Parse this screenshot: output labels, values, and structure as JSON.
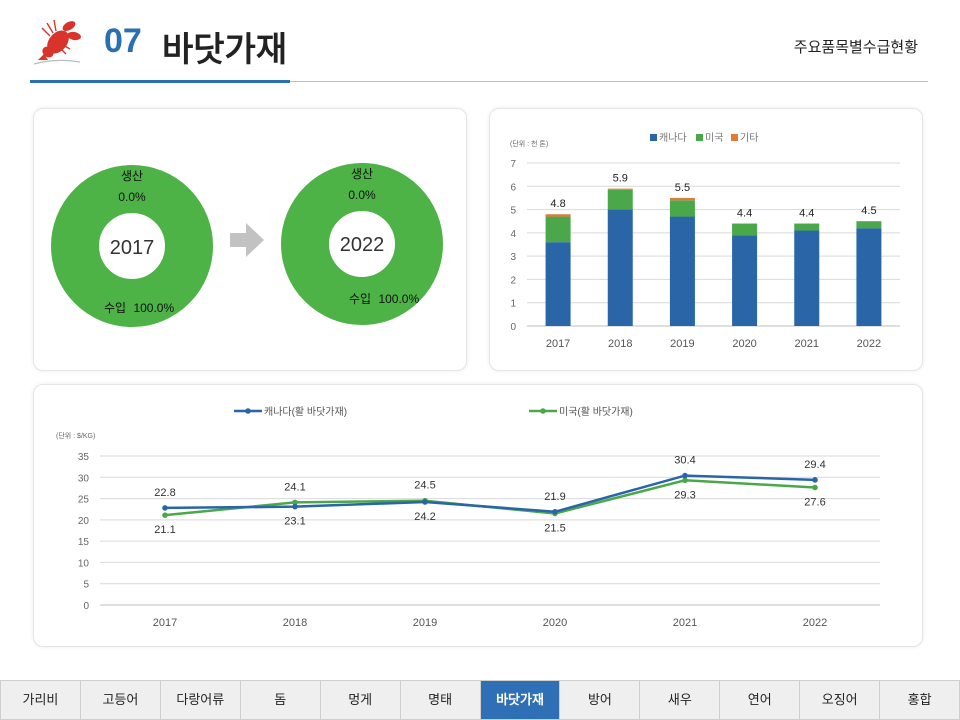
{
  "header": {
    "number": "07",
    "title": "바닷가재",
    "subtitle": "주요품목별수급현황"
  },
  "colors": {
    "accent": "#2a6fb0",
    "canada": "#2965a7",
    "usa": "#4aa84a",
    "other": "#e07b39",
    "donut": "#4db346"
  },
  "chart_data": [
    {
      "type": "pie",
      "variant": "donut",
      "center_label": "2017",
      "slices": [
        {
          "label": "생산",
          "value_text": "0.0%",
          "value": 0.0
        },
        {
          "label": "수입",
          "value_text": "100.0%",
          "value": 100.0
        }
      ]
    },
    {
      "type": "pie",
      "variant": "donut",
      "center_label": "2022",
      "slices": [
        {
          "label": "생산",
          "value_text": "0.0%",
          "value": 0.0
        },
        {
          "label": "수입",
          "value_text": "100.0%",
          "value": 100.0
        }
      ]
    },
    {
      "type": "bar",
      "stacked": true,
      "unit_note": "(단위 : 천 톤)",
      "categories": [
        "2017",
        "2018",
        "2019",
        "2020",
        "2021",
        "2022"
      ],
      "series": [
        {
          "name": "캐나다",
          "values": [
            3.6,
            5.0,
            4.7,
            3.9,
            4.1,
            4.2
          ]
        },
        {
          "name": "미국",
          "values": [
            1.1,
            0.85,
            0.7,
            0.5,
            0.3,
            0.3
          ]
        },
        {
          "name": "기타",
          "values": [
            0.1,
            0.05,
            0.1,
            0.0,
            0.0,
            0.0
          ]
        }
      ],
      "totals": [
        "4.8",
        "5.9",
        "5.5",
        "4.4",
        "4.4",
        "4.5"
      ],
      "yticks": [
        "0",
        "1",
        "2",
        "3",
        "4",
        "5",
        "6",
        "7"
      ],
      "ylim": [
        0,
        7
      ],
      "legend_position": "top"
    },
    {
      "type": "line",
      "unit_note": "(단위 : $/KG)",
      "categories": [
        "2017",
        "2018",
        "2019",
        "2020",
        "2021",
        "2022"
      ],
      "series": [
        {
          "name": "캐나다(활 바닷가재)",
          "values": [
            22.8,
            23.1,
            24.2,
            21.9,
            30.4,
            29.4
          ],
          "labels": [
            "22.8",
            "23.1",
            "24.2",
            "21.9",
            "30.4",
            "29.4"
          ]
        },
        {
          "name": "미국(활 바닷가재)",
          "values": [
            21.1,
            24.1,
            24.5,
            21.5,
            29.3,
            27.6
          ],
          "labels": [
            "21.1",
            "24.1",
            "24.5",
            "21.5",
            "29.3",
            "27.6"
          ]
        }
      ],
      "yticks": [
        "0",
        "5",
        "10",
        "15",
        "20",
        "25",
        "30",
        "35"
      ],
      "ylim": [
        0,
        35
      ],
      "legend_position": "top"
    }
  ],
  "nav": {
    "items": [
      "가리비",
      "고등어",
      "다랑어류",
      "돔",
      "멍게",
      "명태",
      "바닷가재",
      "방어",
      "새우",
      "연어",
      "오징어",
      "홍합"
    ],
    "active": "바닷가재"
  }
}
